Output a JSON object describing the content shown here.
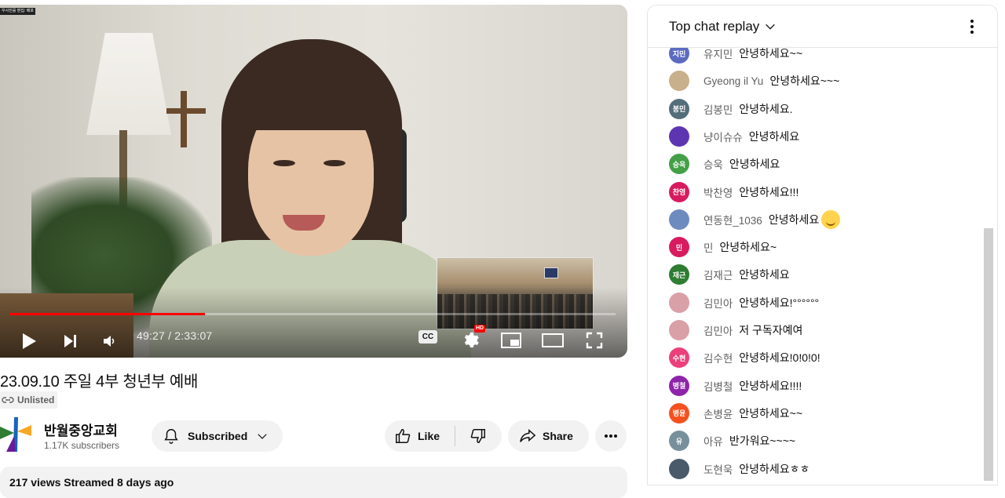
{
  "player": {
    "corner_tag": "우사진를 편집: 배포",
    "time_current": "49:27",
    "time_total": "2:33:07",
    "time_display": "49:27 / 2:33:07",
    "progress_fraction": 0.323,
    "cc_label": "CC",
    "hd_label": "HD",
    "colors": {
      "progress": "#ff0000"
    }
  },
  "video": {
    "title": "23.09.10 주일 4부 청년부 예배",
    "unlisted_label": "Unlisted",
    "stats_line": "217 views  Streamed 8 days ago"
  },
  "channel": {
    "name": "반월중앙교회",
    "subscribers": "1.17K subscribers"
  },
  "actions": {
    "subscribed_label": "Subscribed",
    "like_label": "Like",
    "share_label": "Share"
  },
  "chat": {
    "title": "Top chat replay",
    "messages": [
      {
        "author": "유지민",
        "text": "안녕하세요~~",
        "avatar_text": "지민",
        "avatar_color": "#5c6bc0"
      },
      {
        "author": "Gyeong il Yu",
        "text": "안녕하세요~~~",
        "avatar_text": "",
        "avatar_color": "#c8b08a"
      },
      {
        "author": "김봉민",
        "text": "안녕하세요.",
        "avatar_text": "봉민",
        "avatar_color": "#546e7a"
      },
      {
        "author": "냥이슈슈",
        "text": "안녕하세요",
        "avatar_text": "",
        "avatar_color": "#5e35b1"
      },
      {
        "author": "승욱",
        "text": "안녕하세요",
        "avatar_text": "승욱",
        "avatar_color": "#43a047"
      },
      {
        "author": "박찬영",
        "text": "안녕하세요!!!",
        "avatar_text": "찬영",
        "avatar_color": "#d81b60"
      },
      {
        "author": "연동현_1036",
        "text": "안녕하세요",
        "avatar_text": "",
        "avatar_color": "#6d8bbf",
        "emoji": "smiling-face-icon"
      },
      {
        "author": "민",
        "text": "안녕하세요~",
        "avatar_text": "민",
        "avatar_color": "#d81b60"
      },
      {
        "author": "김재근",
        "text": "안녕하세요",
        "avatar_text": "재근",
        "avatar_color": "#2e7d32"
      },
      {
        "author": "김민아",
        "text": "안녕하세요!°°°°°°",
        "avatar_text": "",
        "avatar_color": "#d9a0a8"
      },
      {
        "author": "김민아",
        "text": "저 구독자예여",
        "avatar_text": "",
        "avatar_color": "#d9a0a8"
      },
      {
        "author": "김수현",
        "text": "안녕하세요!0!0!0!",
        "avatar_text": "수현",
        "avatar_color": "#ec407a"
      },
      {
        "author": "김병철",
        "text": "안녕하세요!!!!",
        "avatar_text": "병철",
        "avatar_color": "#8e24aa"
      },
      {
        "author": "손병윤",
        "text": "안녕하세요~~",
        "avatar_text": "병윤",
        "avatar_color": "#f4511e"
      },
      {
        "author": "아유",
        "text": "반가워요~~~~",
        "avatar_text": "유",
        "avatar_color": "#78909c"
      },
      {
        "author": "도현욱",
        "text": "안녕하세요ㅎㅎ",
        "avatar_text": "",
        "avatar_color": "#4a5a6a"
      }
    ]
  }
}
